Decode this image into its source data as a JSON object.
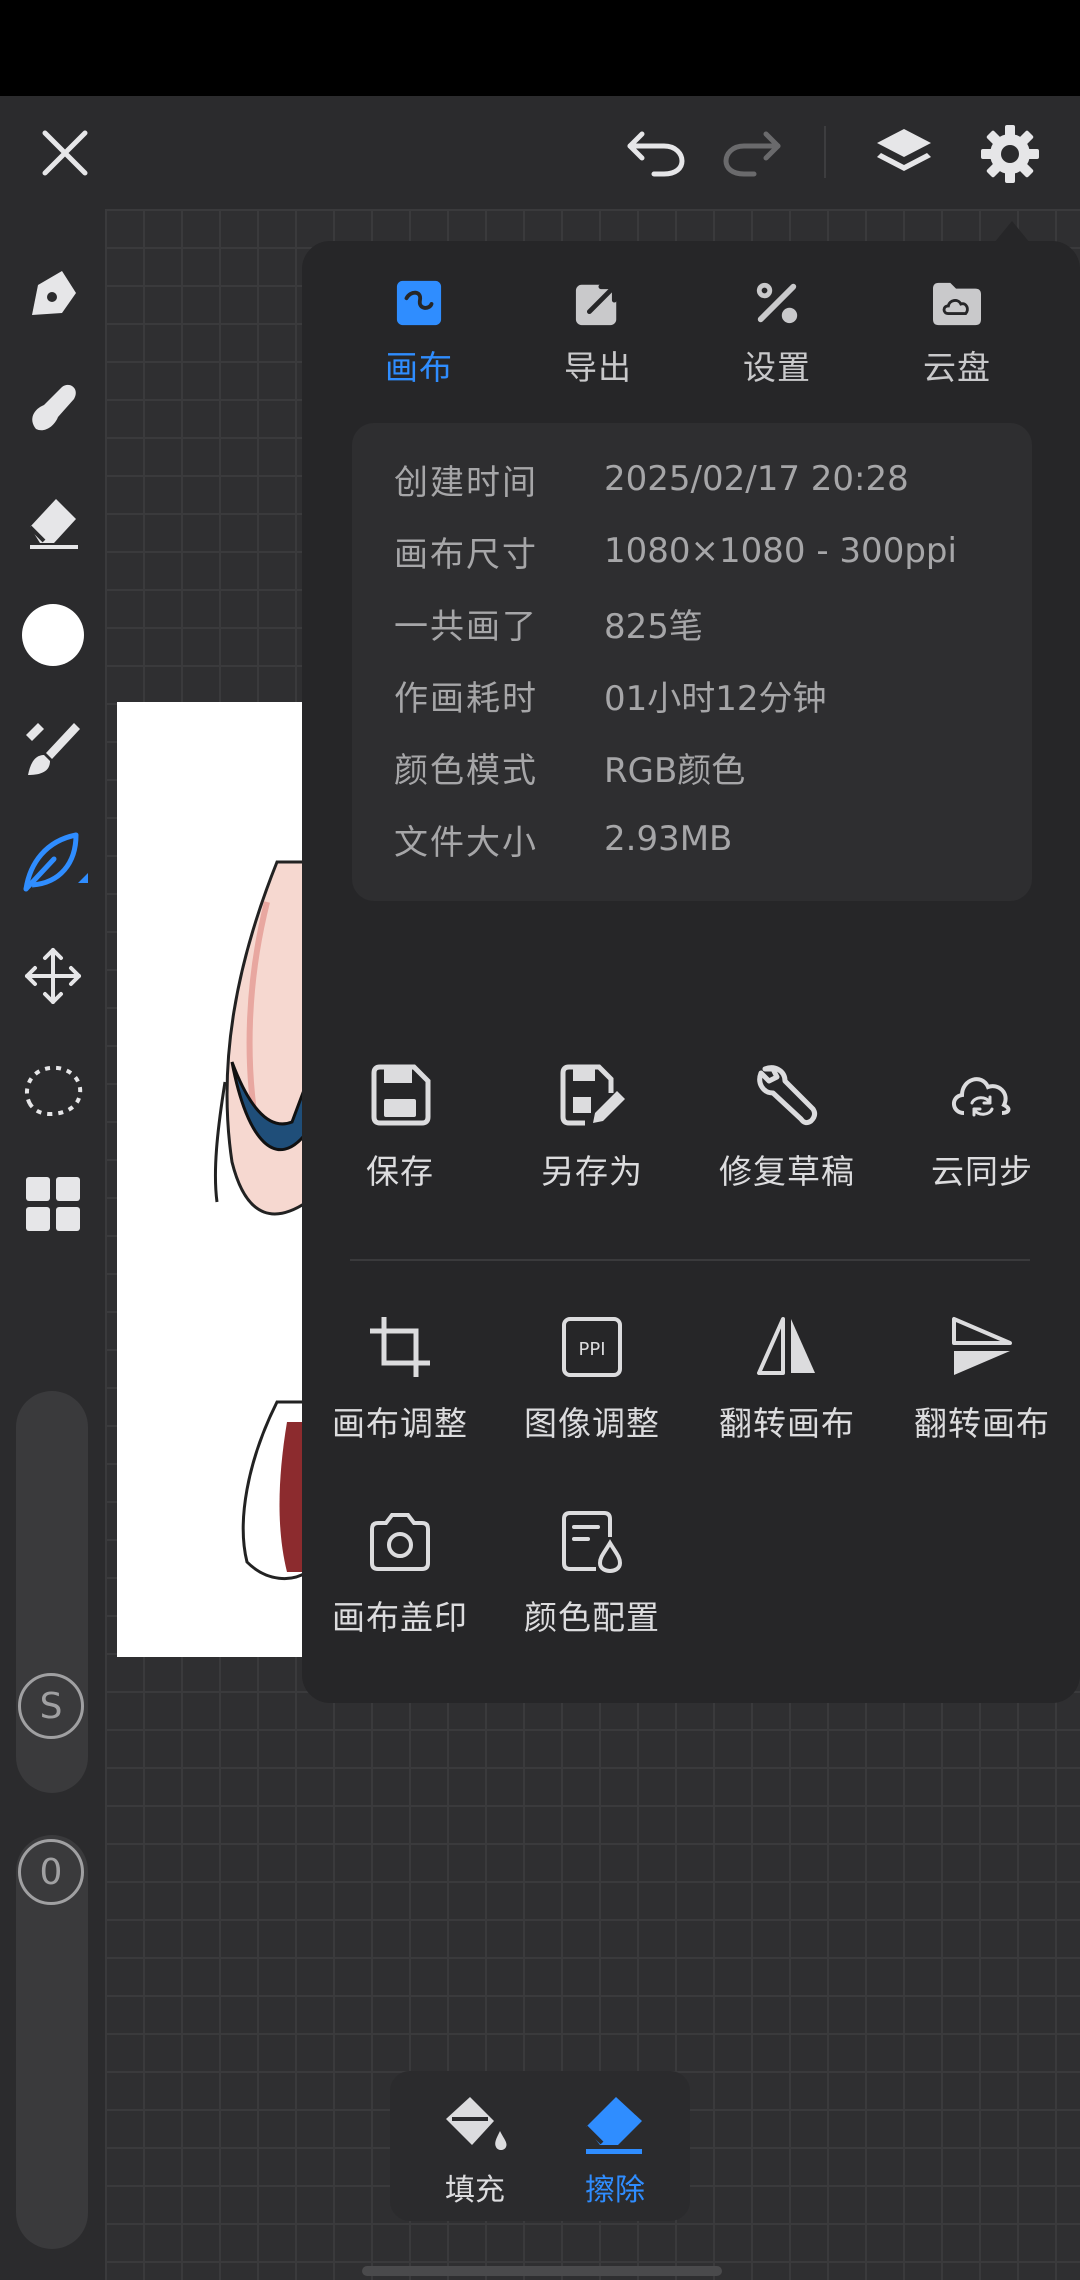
{
  "topbar": {
    "close_icon": "close-icon",
    "undo_icon": "undo-icon",
    "redo_icon": "redo-icon",
    "layers_icon": "layers-icon",
    "settings_icon": "gear-icon"
  },
  "sidebar": {
    "tools": [
      "pen-icon",
      "smudge-icon",
      "eraser-icon",
      "color-swatch",
      "brush-icon",
      "leaf-brush-icon",
      "move-icon",
      "lasso-icon",
      "grid-menu-icon"
    ],
    "active_tool": "leaf-brush-icon",
    "size_button": "S",
    "opacity_button": "0"
  },
  "menu": {
    "tabs": [
      {
        "label": "画布",
        "icon": "canvas-icon",
        "active": true
      },
      {
        "label": "导出",
        "icon": "export-icon",
        "active": false
      },
      {
        "label": "设置",
        "icon": "tools-icon",
        "active": false
      },
      {
        "label": "云盘",
        "icon": "cloud-folder-icon",
        "active": false
      }
    ],
    "info": [
      {
        "key": "创建时间",
        "value": "2025/02/17 20:28"
      },
      {
        "key": "画布尺寸",
        "value": "1080×1080 - 300ppi"
      },
      {
        "key": "一共画了",
        "value": "825笔"
      },
      {
        "key": "作画耗时",
        "value": "01小时12分钟"
      },
      {
        "key": "颜色模式",
        "value": "RGB颜色"
      },
      {
        "key": "文件大小",
        "value": "2.93MB"
      }
    ],
    "actions_row1": [
      {
        "label": "保存",
        "icon": "save-icon"
      },
      {
        "label": "另存为",
        "icon": "save-as-icon"
      },
      {
        "label": "修复草稿",
        "icon": "wrench-icon"
      },
      {
        "label": "云同步",
        "icon": "cloud-sync-icon"
      }
    ],
    "actions_row2": [
      {
        "label": "画布调整",
        "icon": "crop-icon"
      },
      {
        "label": "图像调整",
        "icon": "ppi-icon"
      },
      {
        "label": "翻转画布",
        "icon": "flip-horizontal-icon"
      },
      {
        "label": "翻转画布",
        "icon": "flip-vertical-icon"
      }
    ],
    "actions_row3": [
      {
        "label": "画布盖印",
        "icon": "camera-icon"
      },
      {
        "label": "颜色配置",
        "icon": "color-profile-icon"
      }
    ],
    "ppi_text": "PPI"
  },
  "bottom_tools": [
    {
      "label": "填充",
      "icon": "fill-bucket-icon",
      "active": false
    },
    {
      "label": "擦除",
      "icon": "eraser-icon",
      "active": true
    }
  ],
  "colors": {
    "accent": "#2f8dff",
    "panel": "#262628",
    "background": "#2b2b2d"
  }
}
